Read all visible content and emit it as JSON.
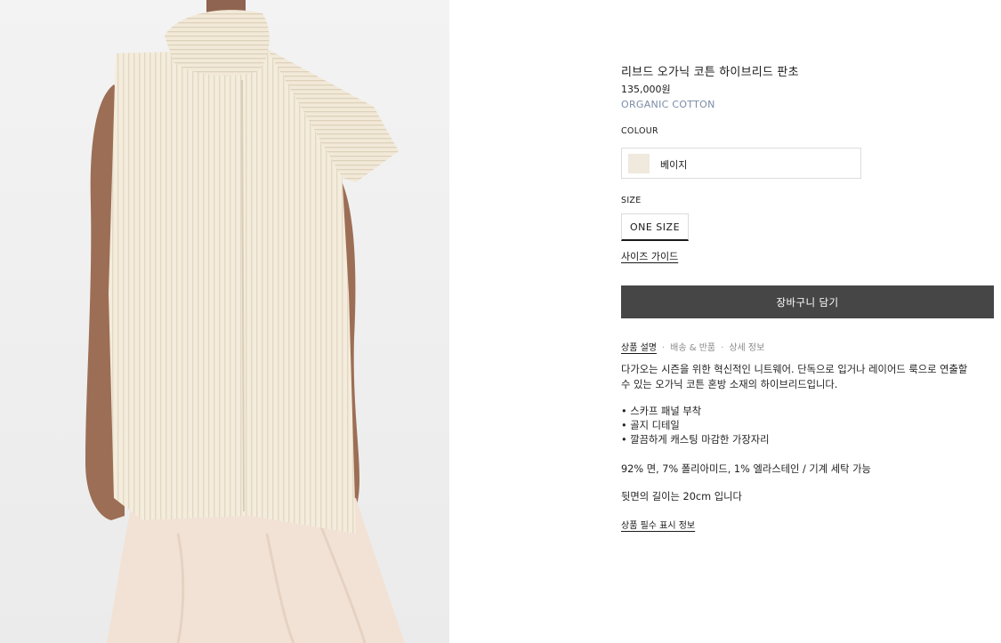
{
  "product": {
    "title": "리브드 오가닉 코튼 하이브리드 판초",
    "price": "135,000원",
    "material": "ORGANIC COTTON"
  },
  "colour": {
    "label": "COLOUR",
    "selected": "베이지",
    "swatch_color": "#efe9de"
  },
  "size": {
    "label": "SIZE",
    "selected": "ONE SIZE",
    "guide_link": "사이즈 가이드"
  },
  "cart": {
    "button_label": "장바구니 담기",
    "button_color": "#464646"
  },
  "tabs": [
    {
      "label": "상품 설명",
      "active": true
    },
    {
      "label": "배송 & 반품",
      "active": false
    },
    {
      "label": "상세 정보",
      "active": false
    }
  ],
  "tab_separator": "·",
  "description": {
    "lines": [
      "다가오는 시즌을 위한 혁신적인 니트웨어. 단독으로 입거나 레이어드 룩으로 연출할",
      "수 있는 오가닉 코튼 혼방 소재의 하이브리드입니다."
    ],
    "bullets": [
      "• 스카프 패널 부착",
      "• 골지 디테일",
      "• 깔끔하게 캐스팅 마감한 가장자리"
    ],
    "composition": "92% 면, 7% 폴리아미드, 1% 엘라스테인 / 기계 세탁 가능",
    "length_note": "뒷면의 길이는 20cm 입니다"
  },
  "required_info_link": "상품 필수 표시 정보",
  "colors": {
    "material_text": "#7b8ca6",
    "garment": "#f4ecdc",
    "skirt": "#f2e2d6",
    "skin": "#9c6e55"
  }
}
